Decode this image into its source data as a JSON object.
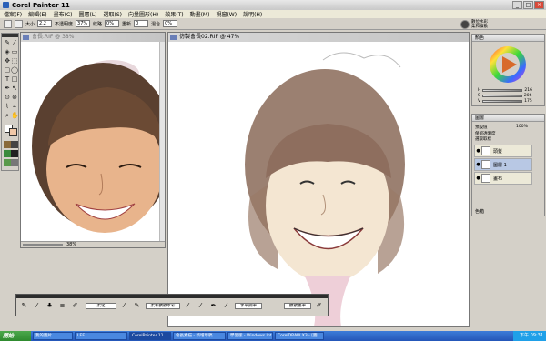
{
  "app": {
    "title": "Corel Painter 11"
  },
  "menu": [
    "檔案(F)",
    "編輯(E)",
    "畫布(C)",
    "圖層(L)",
    "選取(S)",
    "向量圖形(H)",
    "效果(T)",
    "動畫(M)",
    "視窗(W)",
    "說明(H)"
  ],
  "propbar": {
    "size_label": "大小",
    "size_value": "2.2",
    "opacity_label": "不透明度",
    "opacity_value": "37%",
    "grain_label": "紋路",
    "grain_value": "0%",
    "resat_label": "重新",
    "resat_value": "0",
    "bleed_label": "混合",
    "bleed_value": "0%"
  },
  "brush_selector": {
    "line1": "數位水彩",
    "line2": "柔和擴散"
  },
  "doc_left": {
    "title": "會長.RIF @ 38%",
    "zoom": "38%"
  },
  "doc_main": {
    "title": "仿製會長02.RIF @ 47%",
    "zoom": "47%"
  },
  "colors_palette": {
    "title": "顏色",
    "hsv": [
      {
        "label": "H",
        "value": "216"
      },
      {
        "label": "S",
        "value": "206"
      },
      {
        "label": "V",
        "value": "175"
      }
    ]
  },
  "layers_palette": {
    "title": "圖層",
    "mode": "預設值",
    "opacity": "100%",
    "options": [
      "保留透明度",
      "選取取樣"
    ],
    "layers": [
      {
        "name": "頭髮"
      },
      {
        "name": "圖層 1"
      },
      {
        "name": "畫布"
      }
    ],
    "footer": "色箱"
  },
  "brushstrip": {
    "labels": [
      "柔化",
      "柔和擴散水彩",
      "水平鋼筆",
      "擴散畫筆"
    ]
  },
  "taskbar": {
    "start": "開始",
    "tasks": [
      "我的圖片",
      "LEE",
      "CorelPainter 11",
      "會長素描 - 新增草稿...",
      "學習版 - Windows Int...",
      "CorelDRAW X3 - [圖..."
    ],
    "clock": "下午 09:31"
  }
}
